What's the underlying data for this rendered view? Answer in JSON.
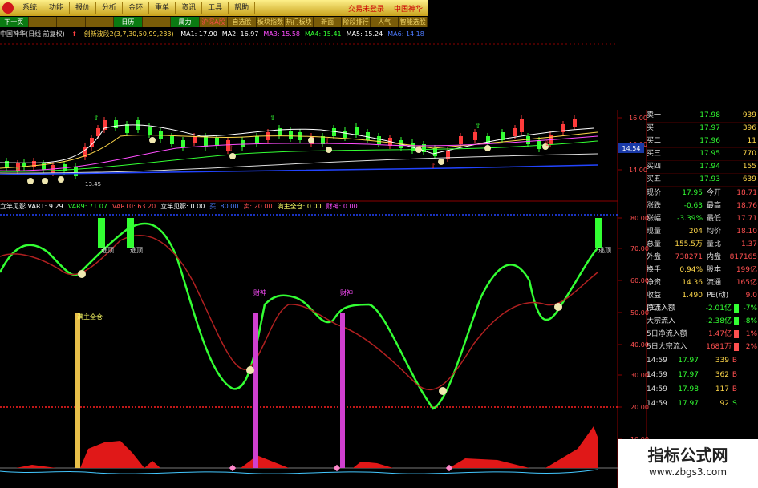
{
  "menubar": {
    "items": [
      "系统",
      "功能",
      "报价",
      "分析",
      "金环",
      "资讯",
      "工具",
      "帮助"
    ],
    "indicator_item": "重单",
    "right": [
      "交易未登录",
      "中国神华"
    ]
  },
  "tabs": [
    {
      "label": "下一页",
      "active": true
    },
    {
      "label": "",
      "active": false
    },
    {
      "label": "",
      "active": false
    },
    {
      "label": "",
      "active": false
    },
    {
      "label": "日历",
      "active": true
    },
    {
      "label": "",
      "active": false
    },
    {
      "label": "属力",
      "active": true
    },
    {
      "label": "沪深A股",
      "active": false,
      "red": true
    },
    {
      "label": "自选股",
      "active": false
    },
    {
      "label": "板块指数",
      "active": false
    },
    {
      "label": "热门板块",
      "active": false
    },
    {
      "label": "新面",
      "active": false
    },
    {
      "label": "阶段排行",
      "active": false
    },
    {
      "label": "人气",
      "active": false
    },
    {
      "label": "智能选股",
      "active": false
    }
  ],
  "chart_header": {
    "stock": "中国神华(日线 前复权)",
    "indicator": "创新波段2(3,7,30,50,99,233)",
    "ma": [
      {
        "label": "MA1: 17.90",
        "color": "#ffffff"
      },
      {
        "label": "MA2: 16.97",
        "color": "#ffffff"
      },
      {
        "label": "MA3: 15.58",
        "color": "#ff4dff"
      },
      {
        "label": "MA4: 15.41",
        "color": "#33ff33"
      },
      {
        "label": "MA5: 15.24",
        "color": "#ffffff"
      },
      {
        "label": "MA6: 14.18",
        "color": "#4d7bff"
      }
    ]
  },
  "indicator_header": [
    {
      "label": "立竿见影 VAR1: 9.29",
      "color": "#ffffff"
    },
    {
      "label": "VAR9: 71.07",
      "color": "#33ff33"
    },
    {
      "label": "VAR10: 63.20",
      "color": "#ff5050"
    },
    {
      "label": "立竿见影: 0.00",
      "color": "#ffffff"
    },
    {
      "label": "买: 80.00",
      "color": "#4d7bff"
    },
    {
      "label": "卖: 20.00",
      "color": "#ff5050"
    },
    {
      "label": "满主全仓: 0.00",
      "color": "#ffff66"
    },
    {
      "label": "财神: 0.00",
      "color": "#ff4dff"
    }
  ],
  "price_axis": [
    "16.00",
    "15.00",
    "14.00"
  ],
  "price_badge": "14.54",
  "osc_axis": [
    "80.00",
    "70.00",
    "60.00",
    "50.00",
    "40.00",
    "30.00",
    "20.00",
    "10.00"
  ],
  "osc_labels": {
    "top": "逃顶",
    "cai": "财神",
    "zhu": "满主全仓"
  },
  "low_label": "13.45",
  "quote": {
    "rows": [
      {
        "label": "卖一",
        "price": "17.98",
        "vol": "939"
      },
      {
        "label": "买一",
        "price": "17.97",
        "vol": "396"
      },
      {
        "label": "买二",
        "price": "17.96",
        "vol": "11"
      },
      {
        "label": "买三",
        "price": "17.95",
        "vol": "770"
      },
      {
        "label": "买四",
        "price": "17.94",
        "vol": "155"
      },
      {
        "label": "买五",
        "price": "17.93",
        "vol": "639"
      }
    ],
    "stats": [
      {
        "l1": "现价",
        "v1": "17.95",
        "c1": "#33ff33",
        "l2": "今开",
        "v2": "18.71"
      },
      {
        "l1": "涨跌",
        "v1": "-0.63",
        "c1": "#33ff33",
        "l2": "最高",
        "v2": "18.76"
      },
      {
        "l1": "涨幅",
        "v1": "-3.39%",
        "c1": "#33ff33",
        "l2": "最低",
        "v2": "17.71"
      },
      {
        "l1": "现量",
        "v1": "204",
        "c1": "#ffd84a",
        "l2": "均价",
        "v2": "18.10"
      },
      {
        "l1": "总量",
        "v1": "155.5万",
        "c1": "#ffd84a",
        "l2": "量比",
        "v2": "1.37"
      },
      {
        "l1": "外盘",
        "v1": "738271",
        "c1": "#ff5050",
        "l2": "内盘",
        "v2": "817165"
      },
      {
        "l1": "换手",
        "v1": "0.94%",
        "c1": "#ffd84a",
        "l2": "股本",
        "v2": "199亿"
      },
      {
        "l1": "净资",
        "v1": "14.36",
        "c1": "#ffd84a",
        "l2": "流通",
        "v2": "165亿"
      },
      {
        "l1": "收益(二)",
        "v1": "1.490",
        "c1": "#ffd84a",
        "l2": "PE(动)",
        "v2": "9.0"
      }
    ],
    "flows": [
      {
        "label": "净流入额",
        "value": "-2.01亿",
        "pct": "-7%",
        "bar": "#33ff33"
      },
      {
        "label": "大宗流入",
        "value": "-2.38亿",
        "pct": "-8%",
        "bar": "#33ff33"
      },
      {
        "label": "5日净流入额",
        "value": "1.47亿",
        "pct": "1%",
        "bar": "#ff5050"
      },
      {
        "label": "5日大宗流入",
        "value": "1681万",
        "pct": "2%",
        "bar": "#ff5050"
      }
    ],
    "ticks": [
      {
        "time": "14:59",
        "price": "17.97",
        "vol": "339",
        "side": "B"
      },
      {
        "time": "14:59",
        "price": "17.97",
        "vol": "362",
        "side": "B"
      },
      {
        "time": "14:59",
        "price": "17.98",
        "vol": "117",
        "side": "B"
      },
      {
        "time": "14:59",
        "price": "17.97",
        "vol": "92",
        "side": "S"
      }
    ]
  },
  "watermark": {
    "title": "指标公式网",
    "url": "www.zbgs3.com"
  },
  "colors": {
    "up": "#ff3b3b",
    "down": "#33ff33",
    "grid_red": "#8b0000",
    "price": "#ffd84a"
  }
}
